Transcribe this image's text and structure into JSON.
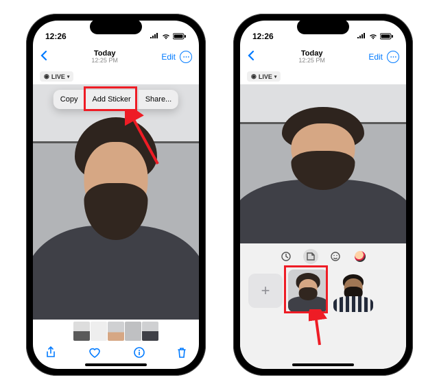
{
  "status": {
    "time": "12:26"
  },
  "nav": {
    "title": "Today",
    "subtitle": "12:25 PM",
    "edit": "Edit"
  },
  "live_badge": "LIVE",
  "context_menu": {
    "copy": "Copy",
    "add_sticker": "Add Sticker",
    "share": "Share..."
  },
  "drawer": {
    "add_label": "+"
  },
  "colors": {
    "accent": "#007aff",
    "highlight": "#ee1c25"
  }
}
